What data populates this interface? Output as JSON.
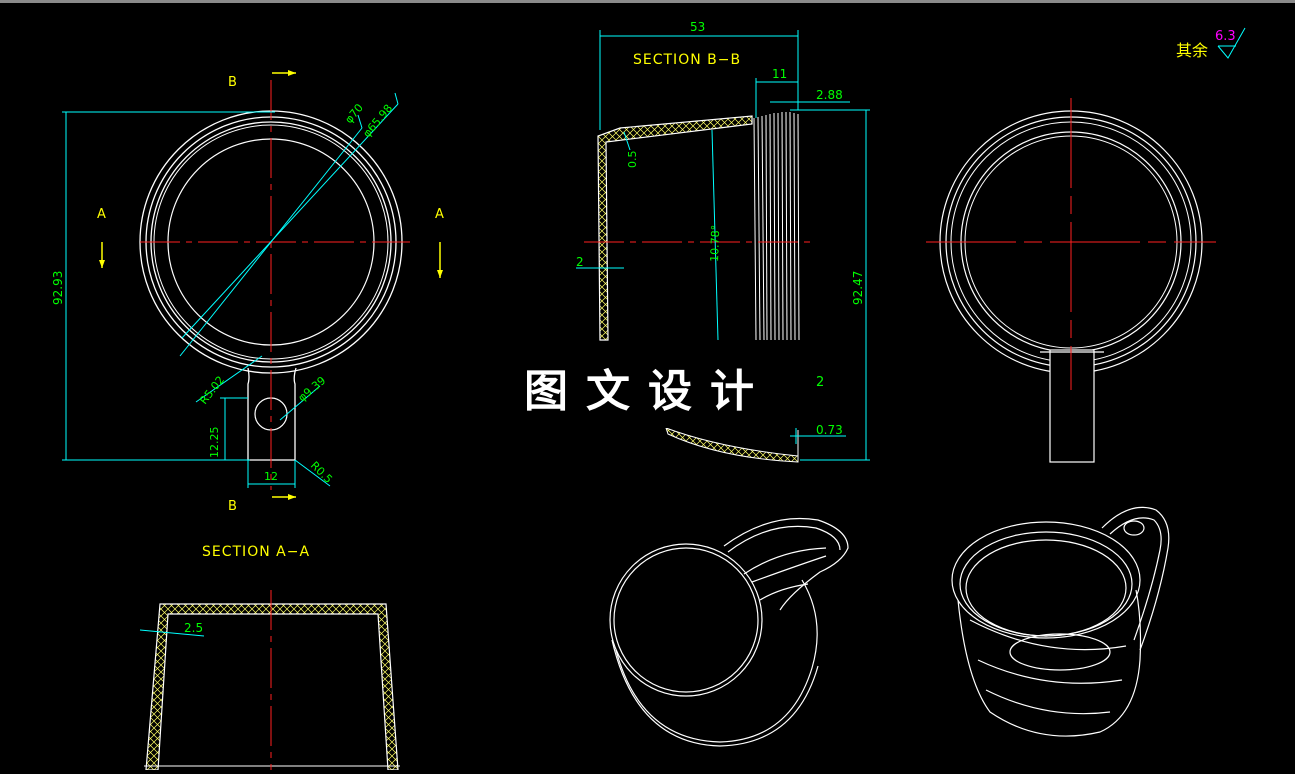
{
  "drawing": {
    "watermark": "图文设计",
    "roughness_note": {
      "label": "其余",
      "value": "6.3"
    },
    "front_view": {
      "section_marker_top": "B",
      "section_marker_bottom": "B",
      "section_marker_left": "A",
      "section_marker_right": "A",
      "dim_height": "92.93",
      "dim_dia_outer": "φ70",
      "dim_dia_inner": "φ65.98",
      "dim_radius_handle": "R5.02",
      "dim_hole": "φ9.39",
      "dim_handle_len": "12.25",
      "dim_handle_width": "12",
      "dim_radius_tip": "R0.5"
    },
    "section_bb": {
      "title": "SECTION  B−B",
      "dim_width": "53",
      "dim_rim": "11",
      "dim_offset": "2.88",
      "dim_thickness_top": "0.5",
      "dim_wall": "2",
      "dim_angle": "10.78°",
      "dim_height": "92.47",
      "dim_right_wall": "2",
      "dim_bottom": "0.73"
    },
    "section_aa": {
      "title": "SECTION  A−A",
      "dim_wall": "2.5"
    }
  },
  "colors": {
    "background": "#000000",
    "outline": "#ffffff",
    "centerline": "#ff2020",
    "dimension": "#00ffff",
    "dim_text": "#00ff00",
    "title_text": "#ffff00",
    "hatch": "#ffff66",
    "section_arrow": "#ffff00",
    "roughness_value": "#ff00ff"
  }
}
